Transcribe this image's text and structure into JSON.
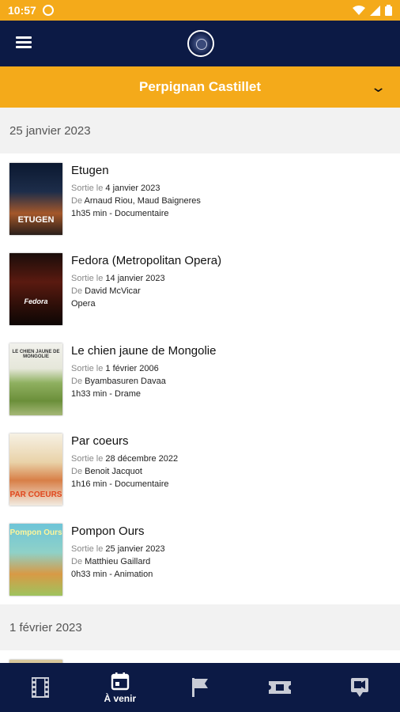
{
  "statusbar": {
    "time": "10:57"
  },
  "header": {
    "cinema": "Perpignan Castillet"
  },
  "labels": {
    "sortie": "Sortie le",
    "de": "De"
  },
  "sections": [
    {
      "date": "25 janvier 2023",
      "movies": [
        {
          "title": "Etugen",
          "release": "4 janvier 2023",
          "directors": "Arnaud Riou, Maud Baigneres",
          "meta": "1h35 min - Documentaire",
          "poster_caption": "ETUGEN"
        },
        {
          "title": "Fedora (Metropolitan Opera)",
          "release": "14 janvier 2023",
          "directors": "David McVicar",
          "meta": "Opera",
          "poster_caption": "Fedora"
        },
        {
          "title": "Le chien jaune de Mongolie",
          "release": "1 février 2006",
          "directors": "Byambasuren Davaa",
          "meta": "1h33 min - Drame",
          "poster_caption": "LE CHIEN JAUNE DE MONGOLIE"
        },
        {
          "title": "Par coeurs",
          "release": "28 décembre 2022",
          "directors": "Benoit Jacquot",
          "meta": "1h16 min - Documentaire",
          "poster_caption": "PAR COEURS"
        },
        {
          "title": "Pompon Ours",
          "release": "25 janvier 2023",
          "directors": "Matthieu Gaillard",
          "meta": "0h33 min - Animation",
          "poster_caption": "Pompon Ours"
        }
      ]
    },
    {
      "date": "1 février 2023"
    }
  ],
  "nav": {
    "items": [
      {
        "label": "",
        "icon": "film-icon"
      },
      {
        "label": "À venir",
        "icon": "calendar-icon"
      },
      {
        "label": "",
        "icon": "flag-icon"
      },
      {
        "label": "",
        "icon": "ticket-icon"
      },
      {
        "label": "",
        "icon": "video-icon"
      }
    ]
  }
}
